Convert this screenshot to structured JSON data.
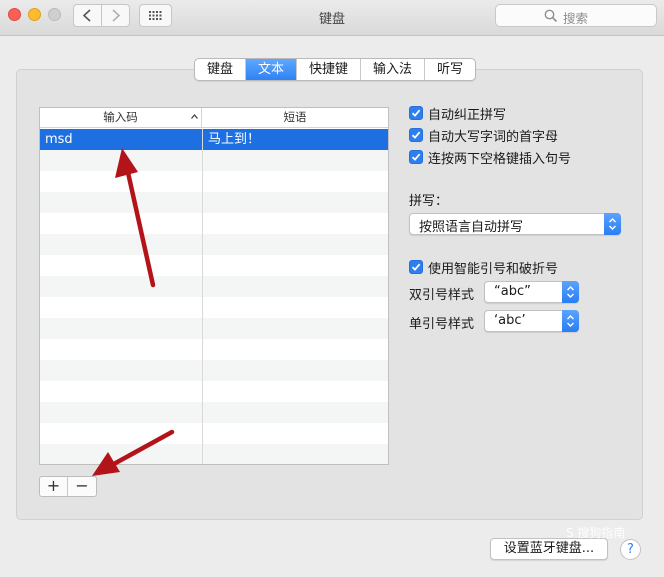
{
  "window": {
    "title": "键盘"
  },
  "search": {
    "placeholder": "搜索"
  },
  "tabs": [
    {
      "label": "键盘",
      "active": false
    },
    {
      "label": "文本",
      "active": true
    },
    {
      "label": "快捷键",
      "active": false
    },
    {
      "label": "输入法",
      "active": false
    },
    {
      "label": "听写",
      "active": false
    }
  ],
  "table": {
    "col1": "输入码",
    "col2": "短语",
    "rows": [
      {
        "code": "msd",
        "phrase": "马上到！",
        "selected": true
      }
    ]
  },
  "toolbar": {
    "add": "+",
    "remove": "−"
  },
  "options": {
    "autocorrect": "自动纠正拼写",
    "capitalize": "自动大写字词的首字母",
    "period": "连按两下空格键插入句号",
    "spelling_label": "拼写：",
    "spelling_value": "按照语言自动拼写",
    "smart_quotes": "使用智能引号和破折号",
    "double_label": "双引号样式",
    "double_value": "“abc”",
    "single_label": "单引号样式",
    "single_value": "‘abc’"
  },
  "buttons": {
    "bluetooth": "设置蓝牙键盘...",
    "help": "?"
  },
  "watermark": "S 搜狗指南",
  "colors": {
    "accent": "#2d7ff1",
    "annotation": "#b3141a"
  },
  "icons": [
    "close-icon",
    "minimize-icon",
    "zoom-icon",
    "chevron-left-icon",
    "chevron-right-icon",
    "grid-icon",
    "search-icon",
    "chevron-up-icon",
    "checkmark-icon",
    "updown-arrows-icon",
    "help-icon"
  ]
}
